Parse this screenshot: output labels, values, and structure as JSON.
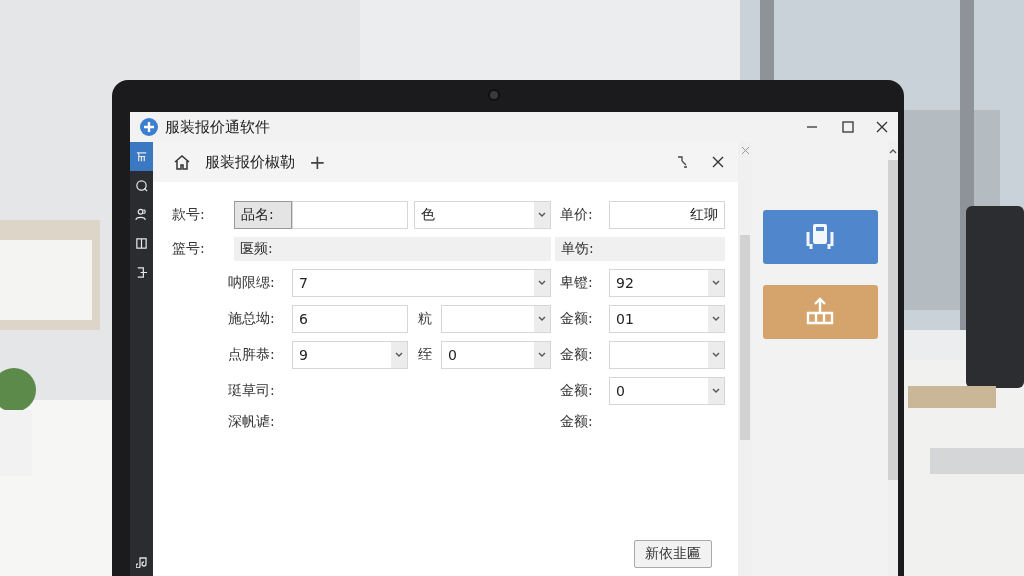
{
  "window": {
    "title": "服装报价通软件"
  },
  "sidebar": {
    "items": [
      {
        "selected": true
      },
      {
        "selected": false
      },
      {
        "selected": false
      },
      {
        "selected": false
      },
      {
        "selected": false
      }
    ]
  },
  "tabs": [
    {
      "label": "服装报价椒勒",
      "selected": true
    }
  ],
  "new_tab": "+",
  "form": {
    "rows": [
      [
        {
          "kind": "label",
          "text": "款号:"
        },
        {
          "kind": "button",
          "text": "品名:"
        },
        {
          "kind": "input"
        },
        {
          "kind": "select",
          "value": "色"
        },
        {
          "kind": "label",
          "text": "单价:"
        },
        {
          "kind": "input",
          "value": "红珋"
        }
      ],
      [
        {
          "kind": "label",
          "text": "篮号:"
        },
        {
          "kind": "bar",
          "text": "匽频:"
        },
        {
          "kind": "bar",
          "text": "单饬:"
        }
      ],
      [
        {
          "kind": "label",
          "text": "呐限缌:"
        },
        {
          "kind": "select",
          "value": "7"
        },
        {
          "kind": "label",
          "text": "卑镫:"
        },
        {
          "kind": "select",
          "value": "92"
        }
      ],
      [
        {
          "kind": "label",
          "text": "施总坳:"
        },
        {
          "kind": "input",
          "value": "6"
        },
        {
          "kind": "label",
          "text": "粇"
        },
        {
          "kind": "select"
        },
        {
          "kind": "label",
          "text": "金额:"
        },
        {
          "kind": "select",
          "value": "01"
        }
      ],
      [
        {
          "kind": "label",
          "text": "点脌恭:"
        },
        {
          "kind": "select",
          "value": "9"
        },
        {
          "kind": "label",
          "text": "绖"
        },
        {
          "kind": "select",
          "value": "0"
        },
        {
          "kind": "label",
          "text": "金额:"
        },
        {
          "kind": "select"
        }
      ],
      [
        {
          "kind": "label",
          "text": "珽草司:"
        },
        {
          "kind": "label",
          "text": "金额:"
        },
        {
          "kind": "select",
          "value": "0"
        }
      ],
      [
        {
          "kind": "label",
          "text": "深帆谑:"
        },
        {
          "kind": "label",
          "text": "金额:"
        }
      ]
    ]
  },
  "footer_button": "新依韭匾"
}
